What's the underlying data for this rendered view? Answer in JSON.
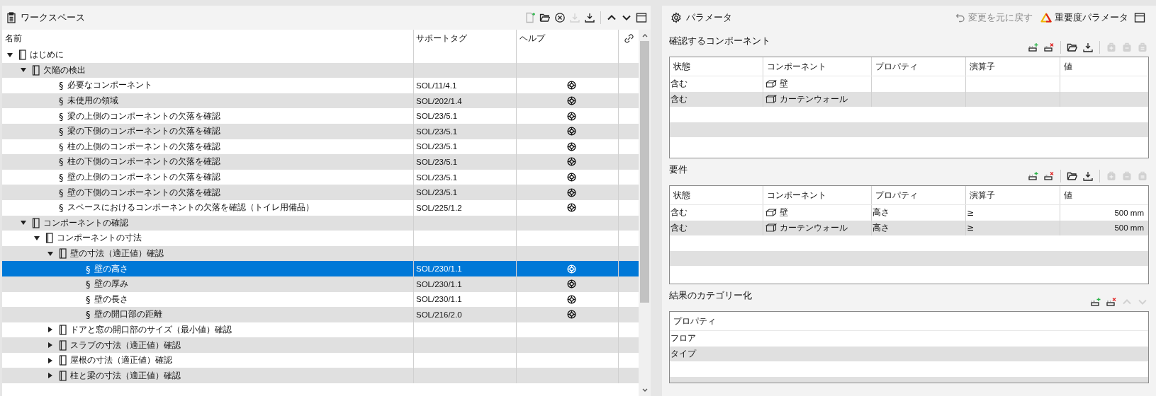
{
  "workspace": {
    "title": "ワークスペース",
    "toolbar": [
      {
        "kind": "new",
        "disabled": false
      },
      {
        "kind": "open",
        "disabled": false
      },
      {
        "kind": "close",
        "disabled": false
      },
      {
        "kind": "export",
        "disabled": true
      },
      {
        "kind": "import",
        "disabled": false
      },
      {
        "kind": "up",
        "disabled": false
      },
      {
        "kind": "down",
        "disabled": false
      },
      {
        "kind": "panel",
        "disabled": false
      }
    ],
    "columns": [
      "名前",
      "サポートタグ",
      "ヘルプ"
    ],
    "tree": [
      {
        "kind": "folder",
        "label": "はじめに",
        "expanded": true,
        "selected": false,
        "children": [
          {
            "kind": "folder",
            "label": "欠陥の検出",
            "expanded": true,
            "selected": false,
            "children": [
              {
                "kind": "rule",
                "symbol": "§",
                "label": "必要なコンポーネント",
                "tag": "SOL/11/4.1",
                "selected": false
              },
              {
                "kind": "rule",
                "symbol": "§",
                "label": "未使用の領域",
                "tag": "SOL/202/1.4",
                "selected": false
              },
              {
                "kind": "rule",
                "symbol": "§",
                "label": "梁の上側のコンポーネントの欠落を確認",
                "tag": "SOL/23/5.1",
                "selected": false
              },
              {
                "kind": "rule",
                "symbol": "§",
                "label": "梁の下側のコンポーネントの欠落を確認",
                "tag": "SOL/23/5.1",
                "selected": false
              },
              {
                "kind": "rule",
                "symbol": "§",
                "label": "柱の上側のコンポーネントの欠落を確認",
                "tag": "SOL/23/5.1",
                "selected": false
              },
              {
                "kind": "rule",
                "symbol": "§",
                "label": "柱の下側のコンポーネントの欠落を確認",
                "tag": "SOL/23/5.1",
                "selected": false
              },
              {
                "kind": "rule",
                "symbol": "§",
                "label": "壁の上側のコンポーネントの欠落を確認",
                "tag": "SOL/23/5.1",
                "selected": false
              },
              {
                "kind": "rule",
                "symbol": "§",
                "label": "壁の下側のコンポーネントの欠落を確認",
                "tag": "SOL/23/5.1",
                "selected": false
              },
              {
                "kind": "rule",
                "symbol": "§",
                "label": "スペースにおけるコンポーネントの欠落を確認（トイレ用備品）",
                "tag": "SOL/225/1.2",
                "selected": false
              }
            ]
          },
          {
            "kind": "folder",
            "label": "コンポーネントの確認",
            "expanded": true,
            "selected": false,
            "children": [
              {
                "kind": "folder",
                "label": "コンポーネントの寸法",
                "expanded": true,
                "selected": false,
                "children": [
                  {
                    "kind": "folder",
                    "label": "壁の寸法（適正値）確認",
                    "expanded": true,
                    "selected": false,
                    "children": [
                      {
                        "kind": "rule",
                        "symbol": "§",
                        "label": "壁の高さ",
                        "tag": "SOL/230/1.1",
                        "selected": true
                      },
                      {
                        "kind": "rule",
                        "symbol": "§",
                        "label": "壁の厚み",
                        "tag": "SOL/230/1.1",
                        "selected": false
                      },
                      {
                        "kind": "rule",
                        "symbol": "§",
                        "label": "壁の長さ",
                        "tag": "SOL/230/1.1",
                        "selected": false
                      },
                      {
                        "kind": "rule",
                        "symbol": "§",
                        "label": "壁の開口部の距離",
                        "tag": "SOL/216/2.0",
                        "selected": false
                      }
                    ]
                  },
                  {
                    "kind": "folder",
                    "label": "ドアと窓の開口部のサイズ（最小値）確認",
                    "expanded": false,
                    "selected": false
                  },
                  {
                    "kind": "folder",
                    "label": "スラブの寸法（適正値）確認",
                    "expanded": false,
                    "selected": false
                  },
                  {
                    "kind": "folder",
                    "label": "屋根の寸法（適正値）確認",
                    "expanded": false,
                    "selected": false
                  },
                  {
                    "kind": "folder",
                    "label": "柱と梁の寸法（適正値）確認",
                    "expanded": false,
                    "selected": false
                  }
                ]
              }
            ]
          }
        ]
      }
    ]
  },
  "parameters": {
    "title": "パラメータ",
    "undo": {
      "label": "変更を元に戻す",
      "disabled": true
    },
    "severity": {
      "label": "重要度パラメータ"
    },
    "sections": [
      {
        "title": "確認するコンポーネント",
        "toolbar": [
          {
            "kind": "add-row",
            "disabled": false
          },
          {
            "kind": "remove-row",
            "disabled": false
          },
          {
            "kind": "open",
            "disabled": false
          },
          {
            "kind": "import",
            "disabled": false
          },
          {
            "kind": "bag-add",
            "disabled": true
          },
          {
            "kind": "bag-remove",
            "disabled": true
          },
          {
            "kind": "bag",
            "disabled": true
          }
        ],
        "columns": [
          "状態",
          "コンポーネント",
          "プロパティ",
          "演算子",
          "値"
        ],
        "rows": [
          [
            "含む",
            "壁",
            "",
            "",
            ""
          ],
          [
            "含む",
            "カーテンウォール",
            "",
            "",
            ""
          ]
        ]
      },
      {
        "title": "要件",
        "toolbar": [
          {
            "kind": "add-row",
            "disabled": false
          },
          {
            "kind": "remove-row",
            "disabled": false
          },
          {
            "kind": "open",
            "disabled": false
          },
          {
            "kind": "import",
            "disabled": false
          },
          {
            "kind": "bag-add",
            "disabled": true
          },
          {
            "kind": "bag-remove",
            "disabled": true
          },
          {
            "kind": "bag",
            "disabled": true
          }
        ],
        "columns": [
          "状態",
          "コンポーネント",
          "プロパティ",
          "演算子",
          "値"
        ],
        "rows": [
          [
            "含む",
            "壁",
            "高さ",
            "≥",
            "500 mm"
          ],
          [
            "含む",
            "カーテンウォール",
            "高さ",
            "≥",
            "500 mm"
          ]
        ]
      },
      {
        "title": "結果のカテゴリー化",
        "toolbar": [
          {
            "kind": "add-row",
            "disabled": false
          },
          {
            "kind": "remove-row",
            "disabled": false
          },
          {
            "kind": "up",
            "disabled": true
          },
          {
            "kind": "down",
            "disabled": true
          }
        ],
        "columns": [
          "プロパティ"
        ],
        "rows": [
          [
            "フロア"
          ],
          [
            "タイプ"
          ]
        ]
      }
    ]
  }
}
